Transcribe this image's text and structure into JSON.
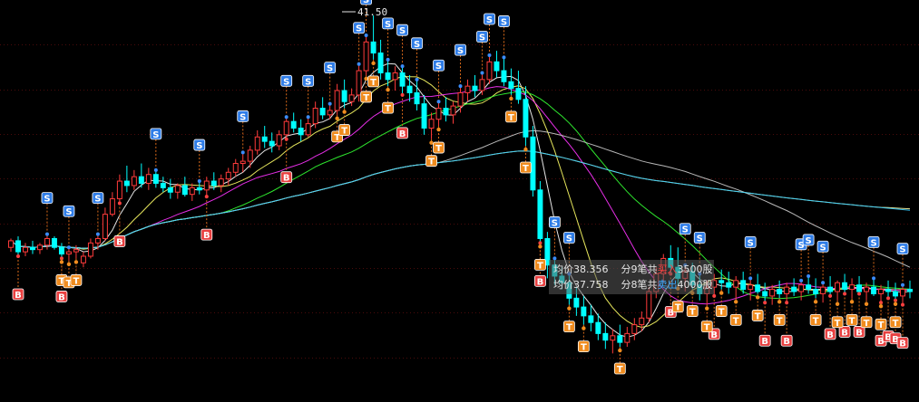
{
  "chart_data": {
    "type": "candlestick",
    "x": [
      1,
      2,
      3,
      4,
      5,
      6,
      7,
      8,
      9,
      10,
      11,
      12,
      13,
      14,
      15,
      16,
      17,
      18,
      19,
      20,
      21,
      22,
      23,
      24,
      25,
      26,
      27,
      28,
      29,
      30,
      31,
      32,
      33,
      34,
      35,
      36,
      37,
      38,
      39,
      40,
      41,
      42,
      43,
      44,
      45,
      46,
      47,
      48,
      49,
      50,
      51,
      52,
      53,
      54,
      55,
      56,
      57,
      58,
      59,
      60,
      61,
      62,
      63,
      64,
      65,
      66,
      67,
      68,
      69,
      70,
      71,
      72,
      73,
      74,
      75,
      76,
      77,
      78,
      79,
      80,
      81,
      82,
      83,
      84,
      85,
      86,
      87,
      88,
      89,
      90,
      91,
      92,
      93,
      94,
      95,
      96,
      97,
      98,
      99,
      100,
      101,
      102,
      103,
      104,
      105,
      106,
      107,
      108,
      109,
      110,
      111,
      112,
      113,
      114,
      115,
      116,
      117,
      118,
      119,
      120,
      121,
      122,
      123,
      124,
      125
    ],
    "ohlc": [
      [
        31.0,
        31.4,
        30.8,
        31.3
      ],
      [
        31.3,
        31.5,
        30.6,
        30.8
      ],
      [
        30.8,
        31.2,
        30.6,
        31.0
      ],
      [
        31.0,
        31.3,
        30.7,
        30.9
      ],
      [
        30.9,
        31.2,
        30.7,
        31.1
      ],
      [
        31.1,
        31.6,
        30.9,
        31.4
      ],
      [
        31.4,
        31.5,
        30.9,
        31.0
      ],
      [
        31.0,
        31.2,
        30.5,
        30.7
      ],
      [
        30.7,
        31.0,
        30.4,
        30.8
      ],
      [
        30.8,
        31.1,
        30.5,
        30.9
      ],
      [
        30.3,
        30.8,
        30.1,
        30.6
      ],
      [
        30.6,
        31.4,
        30.5,
        31.2
      ],
      [
        31.2,
        31.6,
        30.9,
        31.4
      ],
      [
        31.4,
        32.8,
        31.3,
        32.5
      ],
      [
        32.5,
        33.5,
        32.4,
        33.2
      ],
      [
        33.2,
        34.3,
        33.0,
        34.0
      ],
      [
        34.0,
        34.7,
        33.5,
        33.8
      ],
      [
        33.8,
        34.5,
        33.6,
        34.2
      ],
      [
        34.2,
        34.8,
        33.7,
        33.9
      ],
      [
        33.9,
        34.6,
        33.6,
        34.3
      ],
      [
        34.3,
        34.5,
        33.7,
        33.9
      ],
      [
        33.9,
        34.2,
        33.5,
        33.7
      ],
      [
        33.7,
        34.1,
        33.2,
        33.5
      ],
      [
        33.5,
        33.9,
        33.2,
        33.8
      ],
      [
        33.8,
        34.2,
        33.3,
        33.4
      ],
      [
        33.4,
        33.9,
        33.1,
        33.7
      ],
      [
        33.7,
        34.0,
        33.4,
        33.6
      ],
      [
        33.6,
        34.2,
        33.3,
        34.0
      ],
      [
        34.0,
        34.4,
        33.6,
        33.8
      ],
      [
        33.8,
        34.3,
        33.5,
        34.1
      ],
      [
        34.1,
        34.6,
        33.8,
        34.4
      ],
      [
        34.4,
        35.0,
        34.2,
        34.8
      ],
      [
        34.8,
        35.3,
        34.4,
        34.9
      ],
      [
        34.9,
        35.6,
        34.6,
        35.4
      ],
      [
        35.4,
        36.3,
        35.2,
        36.0
      ],
      [
        36.0,
        36.5,
        35.5,
        35.8
      ],
      [
        35.8,
        36.2,
        35.3,
        35.6
      ],
      [
        35.6,
        36.3,
        35.4,
        36.1
      ],
      [
        36.1,
        36.9,
        35.9,
        36.7
      ],
      [
        36.7,
        37.1,
        36.2,
        36.4
      ],
      [
        36.4,
        36.8,
        35.8,
        36.1
      ],
      [
        36.1,
        36.9,
        36.0,
        36.6
      ],
      [
        36.6,
        37.6,
        36.4,
        37.3
      ],
      [
        37.3,
        37.8,
        36.8,
        37.0
      ],
      [
        37.0,
        37.5,
        36.8,
        37.2
      ],
      [
        37.2,
        38.4,
        37.0,
        38.1
      ],
      [
        38.1,
        38.6,
        37.3,
        37.6
      ],
      [
        37.6,
        38.2,
        37.4,
        37.9
      ],
      [
        37.9,
        39.3,
        37.6,
        39.0
      ],
      [
        39.0,
        40.6,
        38.8,
        40.3
      ],
      [
        40.3,
        41.5,
        39.5,
        39.8
      ],
      [
        39.8,
        40.4,
        38.6,
        38.9
      ],
      [
        38.9,
        39.5,
        38.3,
        38.6
      ],
      [
        38.6,
        39.2,
        38.1,
        38.9
      ],
      [
        38.9,
        39.2,
        37.9,
        38.3
      ],
      [
        38.3,
        38.8,
        37.6,
        38.0
      ],
      [
        38.0,
        38.6,
        37.2,
        37.5
      ],
      [
        37.5,
        37.9,
        36.1,
        36.4
      ],
      [
        36.4,
        37.1,
        35.9,
        36.8
      ],
      [
        36.8,
        37.6,
        36.5,
        37.3
      ],
      [
        37.3,
        37.8,
        36.7,
        37.0
      ],
      [
        37.0,
        37.6,
        36.6,
        37.4
      ],
      [
        37.4,
        38.3,
        37.1,
        38.0
      ],
      [
        38.0,
        38.6,
        37.6,
        38.3
      ],
      [
        38.3,
        38.8,
        37.8,
        38.1
      ],
      [
        38.1,
        38.9,
        37.9,
        38.6
      ],
      [
        38.6,
        39.7,
        38.4,
        39.4
      ],
      [
        39.4,
        39.9,
        38.7,
        39.0
      ],
      [
        39.0,
        39.6,
        38.3,
        38.5
      ],
      [
        38.5,
        39.1,
        37.9,
        38.2
      ],
      [
        38.2,
        39.0,
        37.5,
        37.7
      ],
      [
        37.7,
        38.3,
        35.6,
        36.0
      ],
      [
        36.0,
        36.5,
        33.3,
        33.6
      ],
      [
        33.6,
        34.0,
        31.2,
        31.4
      ],
      [
        31.4,
        31.7,
        29.6,
        30.2
      ],
      [
        30.2,
        30.5,
        29.3,
        29.7
      ],
      [
        29.7,
        30.1,
        29.1,
        29.4
      ],
      [
        29.4,
        29.8,
        28.4,
        28.7
      ],
      [
        28.7,
        29.2,
        27.9,
        28.3
      ],
      [
        28.3,
        28.8,
        27.5,
        27.9
      ],
      [
        27.9,
        28.4,
        27.2,
        27.6
      ],
      [
        27.6,
        28.0,
        26.8,
        27.1
      ],
      [
        27.1,
        27.6,
        26.4,
        26.8
      ],
      [
        26.8,
        27.3,
        26.2,
        27.0
      ],
      [
        27.0,
        27.5,
        26.5,
        26.7
      ],
      [
        26.7,
        27.4,
        26.5,
        27.1
      ],
      [
        27.1,
        27.8,
        26.8,
        27.5
      ],
      [
        27.5,
        28.1,
        27.2,
        27.8
      ],
      [
        27.8,
        29.2,
        27.6,
        29.0
      ],
      [
        29.0,
        30.1,
        28.7,
        29.8
      ],
      [
        29.8,
        30.7,
        29.4,
        30.5
      ],
      [
        30.5,
        31.1,
        29.8,
        30.1
      ],
      [
        30.1,
        31.0,
        29.3,
        29.6
      ],
      [
        29.6,
        30.2,
        29.0,
        29.9
      ],
      [
        29.9,
        30.3,
        29.1,
        29.3
      ],
      [
        29.3,
        29.8,
        28.6,
        28.9
      ],
      [
        28.9,
        29.5,
        28.4,
        29.2
      ],
      [
        29.2,
        29.8,
        28.8,
        29.5
      ],
      [
        29.5,
        30.0,
        29.1,
        29.4
      ],
      [
        29.4,
        29.9,
        28.9,
        29.2
      ],
      [
        29.2,
        29.7,
        28.7,
        29.5
      ],
      [
        29.5,
        29.9,
        28.9,
        29.1
      ],
      [
        29.1,
        29.6,
        28.6,
        29.3
      ],
      [
        29.3,
        29.8,
        28.9,
        29.0
      ],
      [
        29.0,
        29.4,
        28.5,
        28.8
      ],
      [
        28.8,
        29.3,
        28.4,
        29.1
      ],
      [
        29.1,
        29.5,
        28.7,
        28.9
      ],
      [
        28.9,
        29.4,
        28.5,
        29.2
      ],
      [
        29.2,
        29.6,
        28.8,
        29.0
      ],
      [
        29.0,
        29.5,
        28.6,
        29.3
      ],
      [
        29.3,
        29.7,
        28.9,
        29.1
      ],
      [
        29.1,
        29.6,
        28.7,
        28.9
      ],
      [
        28.9,
        29.4,
        28.5,
        29.2
      ],
      [
        29.2,
        29.7,
        28.8,
        29.0
      ],
      [
        29.0,
        29.5,
        28.6,
        29.4
      ],
      [
        29.4,
        29.8,
        28.9,
        29.1
      ],
      [
        29.1,
        29.6,
        28.7,
        29.3
      ],
      [
        29.3,
        29.7,
        28.9,
        29.0
      ],
      [
        29.0,
        29.4,
        28.6,
        29.2
      ],
      [
        29.2,
        29.6,
        28.8,
        28.9
      ],
      [
        28.9,
        29.3,
        28.5,
        29.1
      ],
      [
        29.1,
        29.5,
        28.7,
        29.0
      ],
      [
        29.0,
        29.4,
        28.6,
        28.8
      ],
      [
        28.8,
        29.3,
        28.4,
        29.1
      ],
      [
        29.1,
        29.5,
        28.7,
        29.0
      ]
    ],
    "max_label": "41.50",
    "ylim": [
      24.0,
      42.2
    ],
    "grid": true,
    "marks_s": [
      6,
      9,
      13,
      21,
      27,
      33,
      39,
      42,
      45,
      49,
      50,
      53,
      55,
      57,
      60,
      63,
      66,
      67,
      69,
      76,
      78,
      94,
      96,
      103,
      110,
      111,
      113,
      120,
      124
    ],
    "marks_b": [
      2,
      8,
      16,
      28,
      39,
      55,
      74,
      92,
      98,
      105,
      108,
      114,
      116,
      118,
      121,
      122,
      123,
      124
    ],
    "marks_t": [
      8,
      9,
      10,
      46,
      47,
      50,
      51,
      53,
      59,
      60,
      70,
      72,
      74,
      78,
      80,
      85,
      93,
      95,
      97,
      99,
      101,
      104,
      107,
      112,
      115,
      117,
      119,
      121,
      123
    ],
    "tooltip": {
      "buy": {
        "avg_label": "均价",
        "avg": "38.356",
        "count_text": "分9笔共",
        "action": "买入",
        "qty": "3500股"
      },
      "sell": {
        "avg_label": "均价",
        "avg": "37.758",
        "count_text": "分8笔共",
        "action": "卖出",
        "qty": "4000股"
      }
    },
    "colors": {
      "up": "#ff3b3b",
      "down": "#00ffff",
      "ma5": "#ffffff",
      "ma10": "#ffff66",
      "ma20": "#ff33ff",
      "ma30": "#33ff33",
      "ma60": "#cccccc",
      "ma120": "#ffffaa",
      "ma250": "#33ccff",
      "s_mark": "#2f7de8",
      "b_mark": "#e84040",
      "t_mark": "#f08c1f"
    }
  }
}
